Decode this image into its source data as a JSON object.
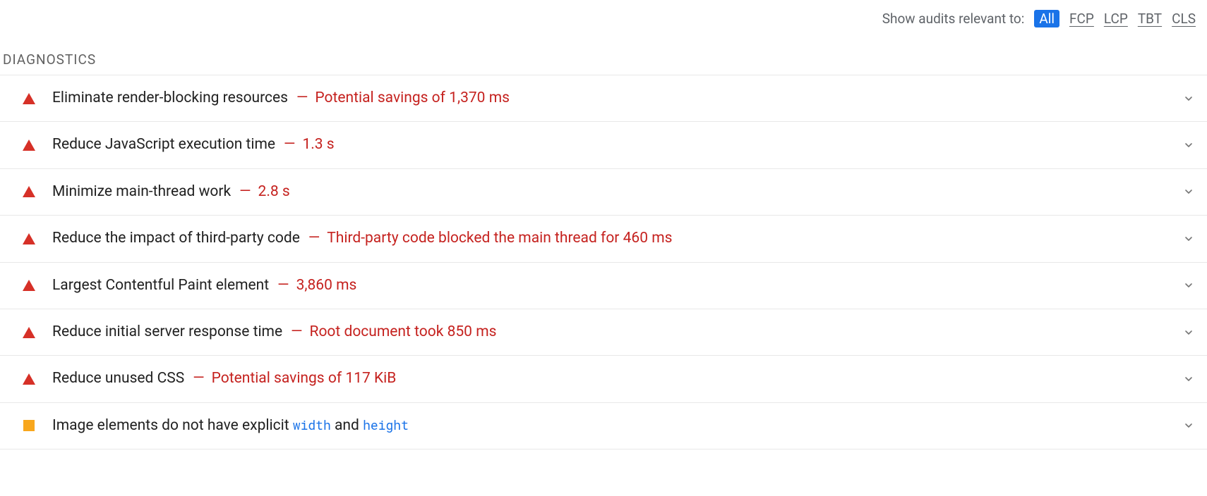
{
  "filters": {
    "label": "Show audits relevant to:",
    "options": [
      {
        "label": "All",
        "active": true
      },
      {
        "label": "FCP",
        "active": false
      },
      {
        "label": "LCP",
        "active": false
      },
      {
        "label": "TBT",
        "active": false
      },
      {
        "label": "CLS",
        "active": false
      }
    ]
  },
  "section": {
    "title": "DIAGNOSTICS"
  },
  "audits": [
    {
      "status": "fail",
      "title": "Eliminate render-blocking resources",
      "detail": "Potential savings of 1,370 ms"
    },
    {
      "status": "fail",
      "title": "Reduce JavaScript execution time",
      "detail": "1.3 s"
    },
    {
      "status": "fail",
      "title": "Minimize main-thread work",
      "detail": "2.8 s"
    },
    {
      "status": "fail",
      "title": "Reduce the impact of third-party code",
      "detail": "Third-party code blocked the main thread for 460 ms"
    },
    {
      "status": "fail",
      "title": "Largest Contentful Paint element",
      "detail": "3,860 ms"
    },
    {
      "status": "fail",
      "title": "Reduce initial server response time",
      "detail": "Root document took 850 ms"
    },
    {
      "status": "fail",
      "title": "Reduce unused CSS",
      "detail": "Potential savings of 117 KiB"
    },
    {
      "status": "warn",
      "title_parts": [
        {
          "text": "Image elements do not have explicit ",
          "type": "plain"
        },
        {
          "text": "width",
          "type": "code"
        },
        {
          "text": " and ",
          "type": "plain"
        },
        {
          "text": "height",
          "type": "code"
        }
      ]
    }
  ]
}
